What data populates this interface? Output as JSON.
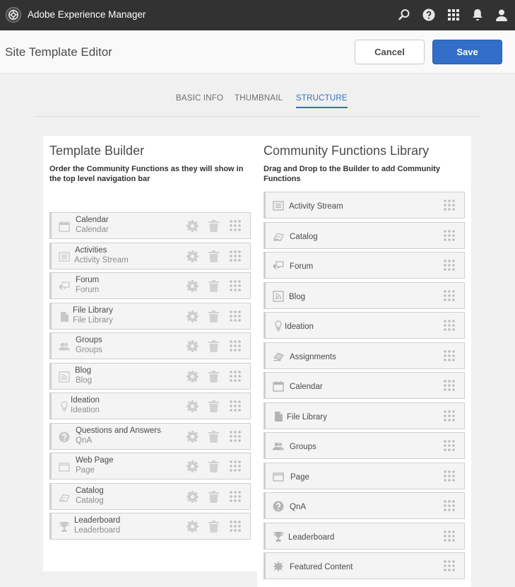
{
  "app": {
    "title": "Adobe Experience Manager"
  },
  "header": {
    "title": "Site Template Editor",
    "cancel_label": "Cancel",
    "save_label": "Save"
  },
  "tabs": [
    {
      "label": "BASIC INFO",
      "active": false
    },
    {
      "label": "THUMBNAIL",
      "active": false
    },
    {
      "label": "STRUCTURE",
      "active": true
    }
  ],
  "builder": {
    "title": "Template Builder",
    "description": "Order the Community Functions as they will show in the top level navigation bar",
    "items": [
      {
        "name": "Calendar",
        "type": "Calendar",
        "icon": "calendar-icon"
      },
      {
        "name": "Activities",
        "type": "Activity Stream",
        "icon": "list-icon"
      },
      {
        "name": "Forum",
        "type": "Forum",
        "icon": "chat-icon"
      },
      {
        "name": "File Library",
        "type": "File Library",
        "icon": "file-icon"
      },
      {
        "name": "Groups",
        "type": "Groups",
        "icon": "people-icon"
      },
      {
        "name": "Blog",
        "type": "Blog",
        "icon": "blog-icon"
      },
      {
        "name": "Ideation",
        "type": "Ideation",
        "icon": "bulb-icon"
      },
      {
        "name": "Questions and Answers",
        "type": "QnA",
        "icon": "question-icon"
      },
      {
        "name": "Web Page",
        "type": "Page",
        "icon": "page-icon"
      },
      {
        "name": "Catalog",
        "type": "Catalog",
        "icon": "catalog-icon"
      },
      {
        "name": "Leaderboard",
        "type": "Leaderboard",
        "icon": "trophy-icon"
      }
    ]
  },
  "library": {
    "title": "Community Functions Library",
    "description": "Drag and Drop to the Builder to add Community Functions",
    "items": [
      {
        "label": "Activity Stream",
        "icon": "list-icon"
      },
      {
        "label": "Catalog",
        "icon": "catalog-icon"
      },
      {
        "label": "Forum",
        "icon": "chat-icon"
      },
      {
        "label": "Blog",
        "icon": "blog-icon"
      },
      {
        "label": "Ideation",
        "icon": "bulb-icon"
      },
      {
        "label": "Assignments",
        "icon": "assignment-icon"
      },
      {
        "label": "Calendar",
        "icon": "calendar-icon"
      },
      {
        "label": "File Library",
        "icon": "file-icon"
      },
      {
        "label": "Groups",
        "icon": "people-icon"
      },
      {
        "label": "Page",
        "icon": "page-icon"
      },
      {
        "label": "QnA",
        "icon": "question-icon"
      },
      {
        "label": "Leaderboard",
        "icon": "trophy-icon"
      },
      {
        "label": "Featured Content",
        "icon": "star-burst-icon"
      }
    ]
  },
  "colors": {
    "topbar": "#323232",
    "accent": "#326ec8",
    "panel": "#ffffff"
  }
}
